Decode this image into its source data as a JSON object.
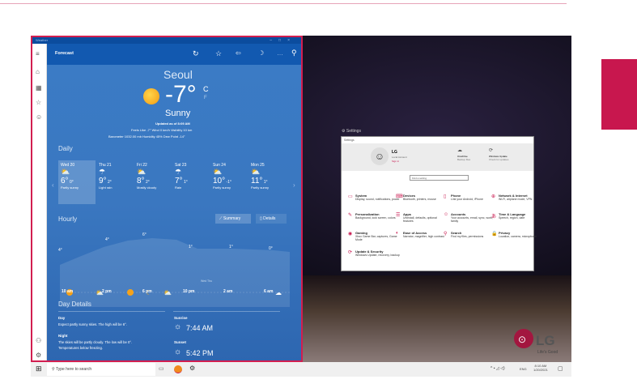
{
  "weather": {
    "window_title": "Weather",
    "header": "Forecast",
    "city": "Seoul",
    "temp": "-7°",
    "unit_c": "C",
    "unit_f": "F",
    "condition": "Sunny",
    "updated": "Updated as of 8:09 AM",
    "details1": "Feels Like  -7°     Wind  0 km/h     Visibility  10 km",
    "details2": "Barometer  1032.00 mb     Humidity  45%     Dew Point  -14°",
    "daily_title": "Daily",
    "days": [
      {
        "name": "Wed 20",
        "hi": "6°",
        "lo": "0°",
        "cond": "Partly sunny"
      },
      {
        "name": "Thu 21",
        "hi": "9°",
        "lo": "2°",
        "cond": "Light rain"
      },
      {
        "name": "Fri 22",
        "hi": "8°",
        "lo": "2°",
        "cond": "Mostly cloudy"
      },
      {
        "name": "Sat 23",
        "hi": "7°",
        "lo": "1°",
        "cond": "Rain"
      },
      {
        "name": "Sun 24",
        "hi": "10°",
        "lo": "-1°",
        "cond": "Partly sunny"
      },
      {
        "name": "Mon 25",
        "hi": "11°",
        "lo": "1°",
        "cond": "Partly sunny"
      }
    ],
    "hourly_title": "Hourly",
    "summary_btn": "Summary",
    "details_btn": "Details",
    "hourly_temps": [
      "4°",
      "4°",
      "6°",
      "1°",
      "1°",
      "0°"
    ],
    "hourly_times": [
      "10 am",
      "2 pm",
      "6 pm",
      "10 pm",
      "2 am",
      "6 am"
    ],
    "day_split": "Wed  Thu",
    "day_details_title": "Day Details",
    "day_label": "Day",
    "day_text": "Expect partly sunny skies. The high will be 6°.",
    "night_label": "Night",
    "night_text1": "The skies will be partly cloudy. The low will be 0°.",
    "night_text2": "Temperatures below freezing.",
    "sunrise_label": "Sunrise",
    "sunrise": "7:44 AM",
    "sunset_label": "Sunset",
    "sunset": "5:42 PM"
  },
  "settings": {
    "caption": "Settings",
    "window_title": "Settings",
    "user": "LG",
    "account": "Local Account",
    "sign_in": "Sign in",
    "onedrive": "OneDrive",
    "onedrive_sub": "Backup files",
    "update": "Windows Update",
    "update_sub": "Check for updates",
    "search_placeholder": "Find a setting",
    "items": [
      {
        "t": "System",
        "d": "Display, sound, notifications, power"
      },
      {
        "t": "Devices",
        "d": "Bluetooth, printers, mouse"
      },
      {
        "t": "Phone",
        "d": "Link your Android, iPhone"
      },
      {
        "t": "Network & Internet",
        "d": "Wi-Fi, airplane mode, VPN"
      },
      {
        "t": "Personalization",
        "d": "Background, lock screen, colors"
      },
      {
        "t": "Apps",
        "d": "Uninstall, defaults, optional features"
      },
      {
        "t": "Accounts",
        "d": "Your accounts, email, sync, work, family"
      },
      {
        "t": "Time & Language",
        "d": "Speech, region, date"
      },
      {
        "t": "Gaming",
        "d": "Xbox Game Bar, captures, Game Mode"
      },
      {
        "t": "Ease of Access",
        "d": "Narrator, magnifier, high contrast"
      },
      {
        "t": "Search",
        "d": "Find my files, permissions"
      },
      {
        "t": "Privacy",
        "d": "Location, camera, microphone"
      },
      {
        "t": "Update & Security",
        "d": "Windows Update, recovery, backup"
      }
    ]
  },
  "taskbar": {
    "search_placeholder": "Type here to search",
    "lang": "ENG",
    "time": "8:10 AM",
    "date": "1/20/2021"
  },
  "logo": {
    "brand": "LG",
    "tagline": "Life's Good"
  },
  "colors": {
    "accent": "#c8174e",
    "weather_blue": "#1259b0"
  }
}
